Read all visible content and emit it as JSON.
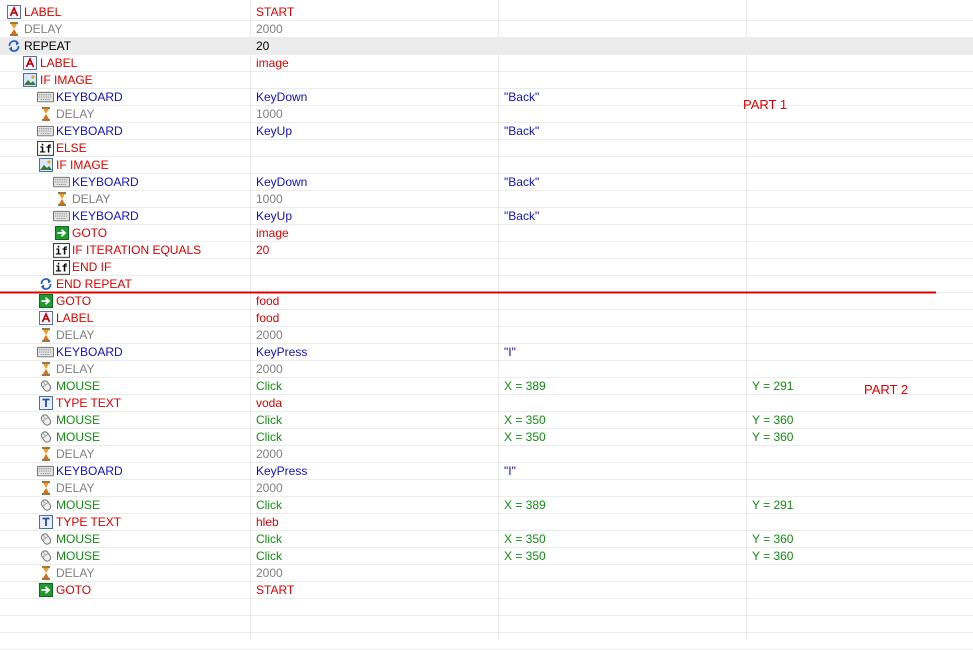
{
  "rows": [
    {
      "indent": 0,
      "icon": "label-icon",
      "cmd": "LABEL",
      "cmd_color": "#e00000",
      "arg1": "START",
      "arg1_color": "#e00000",
      "arg2": "",
      "arg2_color": "",
      "arg3": "",
      "arg3_color": ""
    },
    {
      "indent": 0,
      "icon": "hourglass-icon",
      "cmd": "DELAY",
      "cmd_color": "#808080",
      "arg1": "2000",
      "arg1_color": "#808080",
      "arg2": "",
      "arg2_color": "",
      "arg3": "",
      "arg3_color": ""
    },
    {
      "indent": 0,
      "icon": "repeat-icon",
      "cmd": "REPEAT",
      "cmd_color": "#000000",
      "arg1": "20",
      "arg1_color": "#000000",
      "arg2": "",
      "arg2_color": "",
      "arg3": "",
      "arg3_color": "",
      "selected": true
    },
    {
      "indent": 1,
      "icon": "label-icon",
      "cmd": "LABEL",
      "cmd_color": "#e00000",
      "arg1": "image",
      "arg1_color": "#e00000",
      "arg2": "",
      "arg2_color": "",
      "arg3": "",
      "arg3_color": ""
    },
    {
      "indent": 1,
      "icon": "if-image-icon",
      "cmd": "IF IMAGE",
      "cmd_color": "#e00000",
      "arg1": "",
      "arg1_color": "",
      "arg2": "",
      "arg2_color": "",
      "arg3": "",
      "arg3_color": ""
    },
    {
      "indent": 2,
      "icon": "keyboard-icon",
      "cmd": "KEYBOARD",
      "cmd_color": "#1010d0",
      "arg1": "KeyDown",
      "arg1_color": "#1010d0",
      "arg2": "\"Back\"",
      "arg2_color": "#1010d0",
      "arg3": "",
      "arg3_color": ""
    },
    {
      "indent": 2,
      "icon": "hourglass-icon",
      "cmd": "DELAY",
      "cmd_color": "#808080",
      "arg1": "1000",
      "arg1_color": "#808080",
      "arg2": "",
      "arg2_color": "",
      "arg3": "",
      "arg3_color": ""
    },
    {
      "indent": 2,
      "icon": "keyboard-icon",
      "cmd": "KEYBOARD",
      "cmd_color": "#1010d0",
      "arg1": "KeyUp",
      "arg1_color": "#1010d0",
      "arg2": "\"Back\"",
      "arg2_color": "#1010d0",
      "arg3": "",
      "arg3_color": ""
    },
    {
      "indent": 2,
      "icon": "if-icon",
      "cmd": "ELSE",
      "cmd_color": "#e00000",
      "arg1": "",
      "arg1_color": "",
      "arg2": "",
      "arg2_color": "",
      "arg3": "",
      "arg3_color": ""
    },
    {
      "indent": 2,
      "icon": "if-image-icon",
      "cmd": "IF IMAGE",
      "cmd_color": "#e00000",
      "arg1": "",
      "arg1_color": "",
      "arg2": "",
      "arg2_color": "",
      "arg3": "",
      "arg3_color": ""
    },
    {
      "indent": 3,
      "icon": "keyboard-icon",
      "cmd": "KEYBOARD",
      "cmd_color": "#1010d0",
      "arg1": "KeyDown",
      "arg1_color": "#1010d0",
      "arg2": "\"Back\"",
      "arg2_color": "#1010d0",
      "arg3": "",
      "arg3_color": ""
    },
    {
      "indent": 3,
      "icon": "hourglass-icon",
      "cmd": "DELAY",
      "cmd_color": "#808080",
      "arg1": "1000",
      "arg1_color": "#808080",
      "arg2": "",
      "arg2_color": "",
      "arg3": "",
      "arg3_color": ""
    },
    {
      "indent": 3,
      "icon": "keyboard-icon",
      "cmd": "KEYBOARD",
      "cmd_color": "#1010d0",
      "arg1": "KeyUp",
      "arg1_color": "#1010d0",
      "arg2": "\"Back\"",
      "arg2_color": "#1010d0",
      "arg3": "",
      "arg3_color": ""
    },
    {
      "indent": 3,
      "icon": "goto-icon",
      "cmd": "GOTO",
      "cmd_color": "#e00000",
      "arg1": "image",
      "arg1_color": "#e00000",
      "arg2": "",
      "arg2_color": "",
      "arg3": "",
      "arg3_color": ""
    },
    {
      "indent": 3,
      "icon": "if-icon",
      "cmd": "IF ITERATION EQUALS",
      "cmd_color": "#e00000",
      "arg1": "20",
      "arg1_color": "#e00000",
      "arg2": "",
      "arg2_color": "",
      "arg3": "",
      "arg3_color": ""
    },
    {
      "indent": 3,
      "icon": "if-icon",
      "cmd": "END IF",
      "cmd_color": "#e00000",
      "arg1": "",
      "arg1_color": "",
      "arg2": "",
      "arg2_color": "",
      "arg3": "",
      "arg3_color": ""
    },
    {
      "indent": 2,
      "icon": "repeat-icon",
      "cmd": "END REPEAT",
      "cmd_color": "#e00000",
      "arg1": "",
      "arg1_color": "",
      "arg2": "",
      "arg2_color": "",
      "arg3": "",
      "arg3_color": ""
    },
    {
      "indent": 2,
      "icon": "goto-icon",
      "cmd": "GOTO",
      "cmd_color": "#e00000",
      "arg1": "food",
      "arg1_color": "#e00000",
      "arg2": "",
      "arg2_color": "",
      "arg3": "",
      "arg3_color": ""
    },
    {
      "indent": 2,
      "icon": "label-icon",
      "cmd": "LABEL",
      "cmd_color": "#e00000",
      "arg1": "food",
      "arg1_color": "#e00000",
      "arg2": "",
      "arg2_color": "",
      "arg3": "",
      "arg3_color": ""
    },
    {
      "indent": 2,
      "icon": "hourglass-icon",
      "cmd": "DELAY",
      "cmd_color": "#808080",
      "arg1": "2000",
      "arg1_color": "#808080",
      "arg2": "",
      "arg2_color": "",
      "arg3": "",
      "arg3_color": ""
    },
    {
      "indent": 2,
      "icon": "keyboard-icon",
      "cmd": "KEYBOARD",
      "cmd_color": "#1010d0",
      "arg1": "KeyPress",
      "arg1_color": "#1010d0",
      "arg2": "\"I\"",
      "arg2_color": "#1010d0",
      "arg3": "",
      "arg3_color": ""
    },
    {
      "indent": 2,
      "icon": "hourglass-icon",
      "cmd": "DELAY",
      "cmd_color": "#808080",
      "arg1": "2000",
      "arg1_color": "#808080",
      "arg2": "",
      "arg2_color": "",
      "arg3": "",
      "arg3_color": ""
    },
    {
      "indent": 2,
      "icon": "mouse-icon",
      "cmd": "MOUSE",
      "cmd_color": "#109010",
      "arg1": "Click",
      "arg1_color": "#109010",
      "arg2": "X = 389",
      "arg2_color": "#109010",
      "arg3": "Y = 291",
      "arg3_color": "#109010"
    },
    {
      "indent": 2,
      "icon": "type-text-icon",
      "cmd": "TYPE TEXT",
      "cmd_color": "#e00000",
      "arg1": "voda",
      "arg1_color": "#e00000",
      "arg2": "",
      "arg2_color": "",
      "arg3": "",
      "arg3_color": ""
    },
    {
      "indent": 2,
      "icon": "mouse-icon",
      "cmd": "MOUSE",
      "cmd_color": "#109010",
      "arg1": "Click",
      "arg1_color": "#109010",
      "arg2": "X = 350",
      "arg2_color": "#109010",
      "arg3": "Y = 360",
      "arg3_color": "#109010"
    },
    {
      "indent": 2,
      "icon": "mouse-icon",
      "cmd": "MOUSE",
      "cmd_color": "#109010",
      "arg1": "Click",
      "arg1_color": "#109010",
      "arg2": "X = 350",
      "arg2_color": "#109010",
      "arg3": "Y = 360",
      "arg3_color": "#109010"
    },
    {
      "indent": 2,
      "icon": "hourglass-icon",
      "cmd": "DELAY",
      "cmd_color": "#808080",
      "arg1": "2000",
      "arg1_color": "#808080",
      "arg2": "",
      "arg2_color": "",
      "arg3": "",
      "arg3_color": ""
    },
    {
      "indent": 2,
      "icon": "keyboard-icon",
      "cmd": "KEYBOARD",
      "cmd_color": "#1010d0",
      "arg1": "KeyPress",
      "arg1_color": "#1010d0",
      "arg2": "\"I\"",
      "arg2_color": "#1010d0",
      "arg3": "",
      "arg3_color": ""
    },
    {
      "indent": 2,
      "icon": "hourglass-icon",
      "cmd": "DELAY",
      "cmd_color": "#808080",
      "arg1": "2000",
      "arg1_color": "#808080",
      "arg2": "",
      "arg2_color": "",
      "arg3": "",
      "arg3_color": ""
    },
    {
      "indent": 2,
      "icon": "mouse-icon",
      "cmd": "MOUSE",
      "cmd_color": "#109010",
      "arg1": "Click",
      "arg1_color": "#109010",
      "arg2": "X = 389",
      "arg2_color": "#109010",
      "arg3": "Y = 291",
      "arg3_color": "#109010"
    },
    {
      "indent": 2,
      "icon": "type-text-icon",
      "cmd": "TYPE TEXT",
      "cmd_color": "#e00000",
      "arg1": "hleb",
      "arg1_color": "#e00000",
      "arg2": "",
      "arg2_color": "",
      "arg3": "",
      "arg3_color": ""
    },
    {
      "indent": 2,
      "icon": "mouse-icon",
      "cmd": "MOUSE",
      "cmd_color": "#109010",
      "arg1": "Click",
      "arg1_color": "#109010",
      "arg2": "X = 350",
      "arg2_color": "#109010",
      "arg3": "Y = 360",
      "arg3_color": "#109010"
    },
    {
      "indent": 2,
      "icon": "mouse-icon",
      "cmd": "MOUSE",
      "cmd_color": "#109010",
      "arg1": "Click",
      "arg1_color": "#109010",
      "arg2": "X = 350",
      "arg2_color": "#109010",
      "arg3": "Y = 360",
      "arg3_color": "#109010"
    },
    {
      "indent": 2,
      "icon": "hourglass-icon",
      "cmd": "DELAY",
      "cmd_color": "#808080",
      "arg1": "2000",
      "arg1_color": "#808080",
      "arg2": "",
      "arg2_color": "",
      "arg3": "",
      "arg3_color": ""
    },
    {
      "indent": 2,
      "icon": "goto-icon",
      "cmd": "GOTO",
      "cmd_color": "#e00000",
      "arg1": "START",
      "arg1_color": "#e00000",
      "arg2": "",
      "arg2_color": "",
      "arg3": "",
      "arg3_color": ""
    }
  ],
  "annotations": {
    "part1": "PART 1",
    "part2": "PART 2",
    "color": "#e00000"
  }
}
